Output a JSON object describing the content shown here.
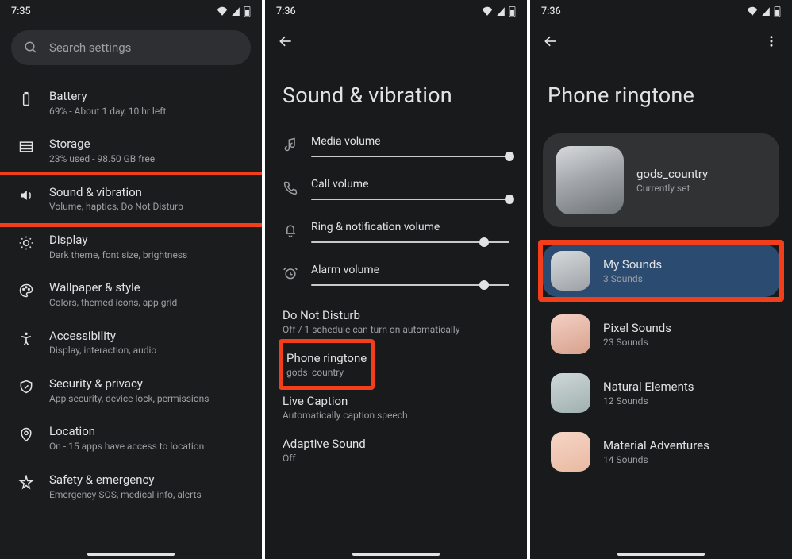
{
  "statusIcons": {
    "wifi": "wifi",
    "signal": "signal",
    "battery": "battery-half"
  },
  "s1": {
    "time": "7:35",
    "search_placeholder": "Search settings",
    "items": [
      {
        "icon": "battery",
        "title": "Battery",
        "sub": "69% - About 1 day, 10 hr left"
      },
      {
        "icon": "storage",
        "title": "Storage",
        "sub": "23% used - 98.50 GB free"
      },
      {
        "icon": "volume",
        "title": "Sound & vibration",
        "sub": "Volume, haptics, Do Not Disturb",
        "highlight": true
      },
      {
        "icon": "display",
        "title": "Display",
        "sub": "Dark theme, font size, brightness"
      },
      {
        "icon": "palette",
        "title": "Wallpaper & style",
        "sub": "Colors, themed icons, app grid"
      },
      {
        "icon": "access",
        "title": "Accessibility",
        "sub": "Display, interaction, audio"
      },
      {
        "icon": "shield",
        "title": "Security & privacy",
        "sub": "App security, device lock, permissions"
      },
      {
        "icon": "pin",
        "title": "Location",
        "sub": "On - 15 apps have access to location"
      },
      {
        "icon": "star",
        "title": "Safety & emergency",
        "sub": "Emergency SOS, medical info, alerts"
      }
    ]
  },
  "s2": {
    "time": "7:36",
    "title": "Sound & vibration",
    "sliders": [
      {
        "icon": "note",
        "label": "Media volume",
        "pos": 1.0
      },
      {
        "icon": "phone",
        "label": "Call volume",
        "pos": 1.0
      },
      {
        "icon": "bell",
        "label": "Ring & notification volume",
        "pos": 0.87
      },
      {
        "icon": "alarm",
        "label": "Alarm volume",
        "pos": 0.87
      }
    ],
    "settings": [
      {
        "t": "Do Not Disturb",
        "s": "Off / 1 schedule can turn on automatically"
      },
      {
        "t": "Phone ringtone",
        "s": "gods_country",
        "highlight": true
      },
      {
        "t": "Live Caption",
        "s": "Automatically caption speech"
      },
      {
        "t": "Adaptive Sound",
        "s": "Off"
      }
    ]
  },
  "s3": {
    "time": "7:36",
    "title": "Phone ringtone",
    "current": {
      "name": "gods_country",
      "sub": "Currently set",
      "grad": "linear-gradient(160deg,#d7dadd 0%,#a3a7ab 45%,#6e7377 100%)"
    },
    "cats": [
      {
        "name": "My Sounds",
        "sub": "3 Sounds",
        "grad": "linear-gradient(160deg,#d7dadd,#9da1a5)",
        "sel": true,
        "highlight": true
      },
      {
        "name": "Pixel Sounds",
        "sub": "23 Sounds",
        "grad": "linear-gradient(160deg,#f3d0c4,#d8a18d)"
      },
      {
        "name": "Natural Elements",
        "sub": "12 Sounds",
        "grad": "linear-gradient(160deg,#cfd8d8,#9fb0af)"
      },
      {
        "name": "Material Adventures",
        "sub": "14 Sounds",
        "grad": "linear-gradient(160deg,#f6d6c6,#e9b9a2)"
      }
    ]
  }
}
